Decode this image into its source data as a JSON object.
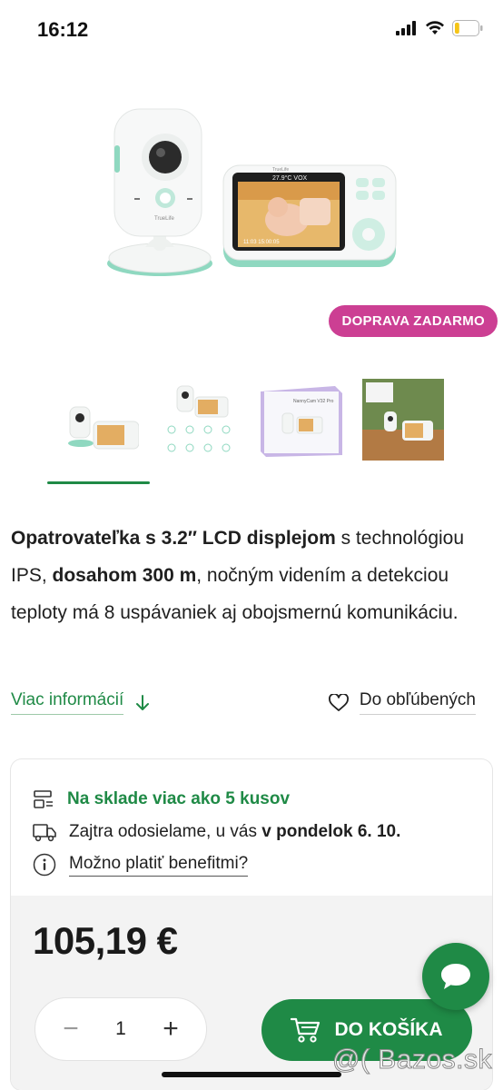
{
  "status_bar": {
    "time": "16:12",
    "icons": [
      "cellular-signal-icon",
      "wifi-icon",
      "battery-icon"
    ],
    "battery_level": 0.2
  },
  "product": {
    "badge": "DOPRAVA ZADARMO",
    "thumbnails_count": 4,
    "selected_thumbnail": 0,
    "device_screen_text": {
      "screen_top": "27.9°C  VOX",
      "screen_bottom": "11:03  15:00:05"
    },
    "brand_on_device": "TrueLife",
    "box_label": "NannyCam V32 Pro",
    "description": {
      "part1": "Opatrovateľka s 3.2″ LCD displejom",
      "part2": " s technológiou IPS, ",
      "part3": "dosahom 300 m",
      "part4": ", nočným videním a detekciou teploty má 8 uspávaniek aj obojsmernú komunikáciu."
    },
    "more_info_label": "Viac informácií",
    "favorite_label": "Do obľúbených"
  },
  "buy_box": {
    "stock_text": "Na sklade viac ako 5 kusov",
    "shipping_prefix": "Zajtra odosielame, u vás ",
    "shipping_date": "v pondelok 6. 10.",
    "benefit_text": "Možno platiť benefitmi?",
    "price": "105,19 €",
    "quantity": "1",
    "qty_minus": "−",
    "qty_plus": "+",
    "add_to_cart_label": "DO KOŠÍKA"
  },
  "watermark": "@( Bazos.sk",
  "colors": {
    "accent_green": "#1f8a46",
    "badge_pink": "#cc3f93",
    "mint": "#8fd8c0"
  }
}
